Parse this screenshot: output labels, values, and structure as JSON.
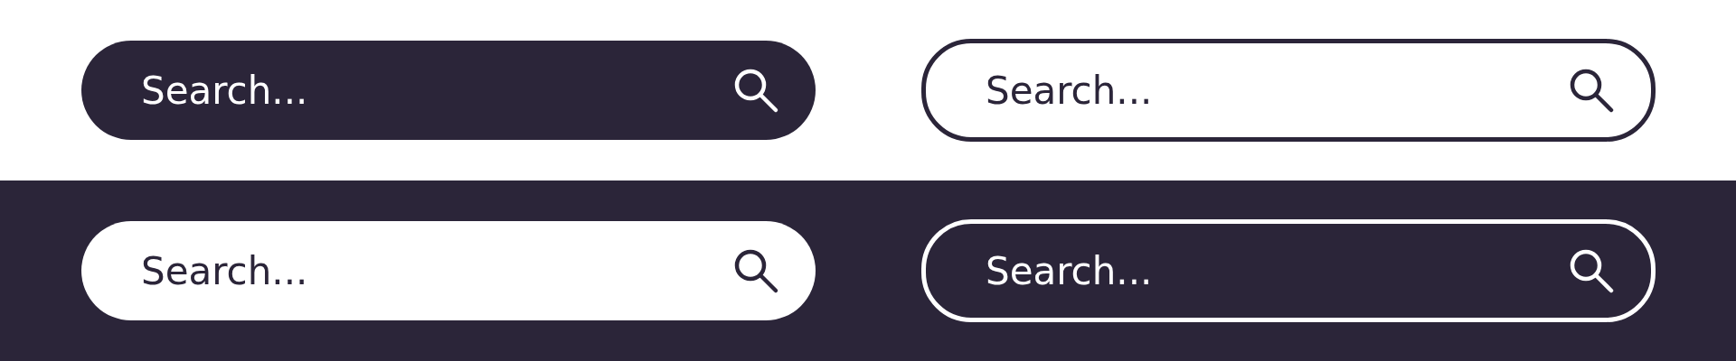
{
  "panels": [
    {
      "kind": "light",
      "search_bars": [
        {
          "kind": "filled",
          "placeholder": "Search..."
        },
        {
          "kind": "outlined",
          "placeholder": "Search..."
        }
      ]
    },
    {
      "kind": "dark",
      "search_bars": [
        {
          "kind": "filled",
          "placeholder": "Search..."
        },
        {
          "kind": "outlined",
          "placeholder": "Search..."
        }
      ]
    }
  ]
}
